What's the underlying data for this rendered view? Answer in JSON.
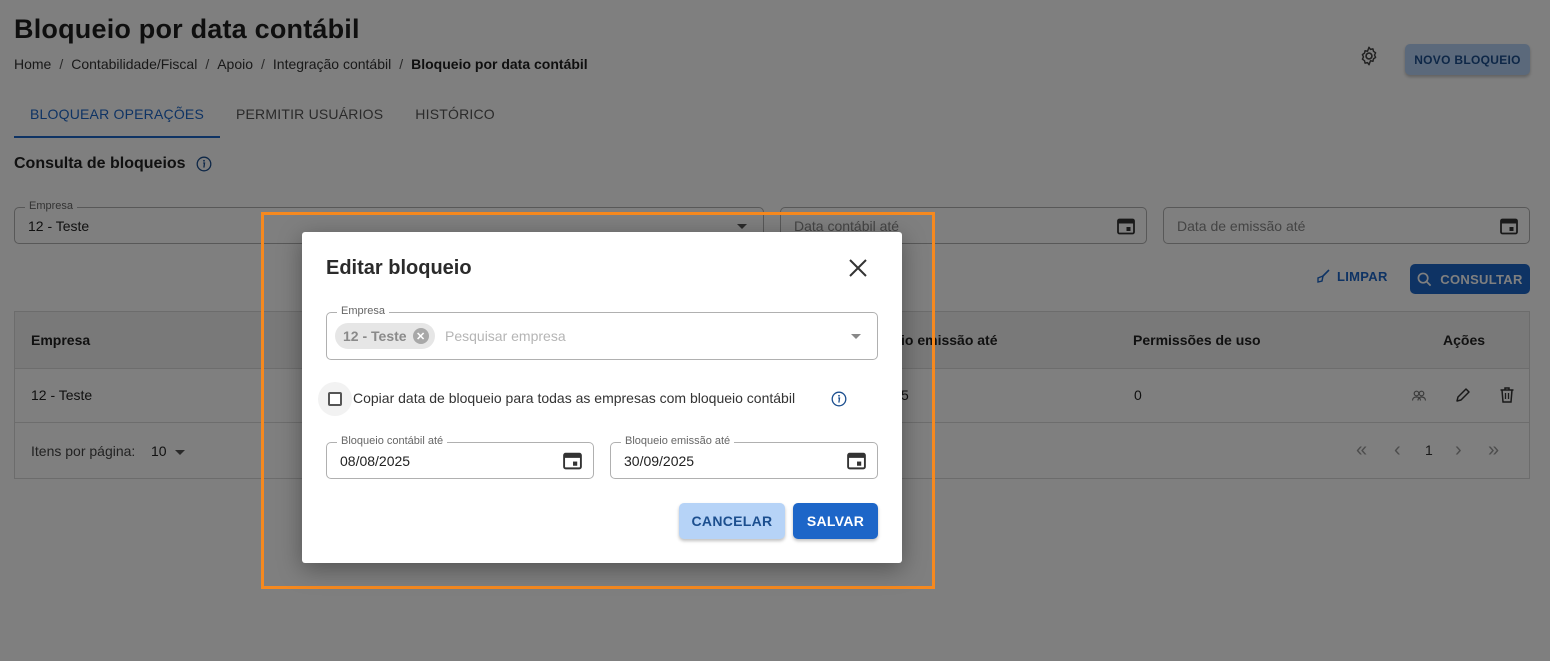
{
  "page": {
    "title": "Bloqueio por data contábil",
    "breadcrumb": [
      "Home",
      "Contabilidade/Fiscal",
      "Apoio",
      "Integração contábil",
      "Bloqueio por data contábil"
    ],
    "new_button": "NOVO BLOQUEIO"
  },
  "tabs": [
    "BLOQUEAR OPERAÇÕES",
    "PERMITIR USUÁRIOS",
    "HISTÓRICO"
  ],
  "filters": {
    "section_title": "Consulta de bloqueios",
    "empresa_label": "Empresa",
    "empresa_value": "12 - Teste",
    "data_contabil_placeholder": "Data contábil até",
    "data_emissao_placeholder": "Data de emissão até",
    "limpar": "LIMPAR",
    "consultar": "CONSULTAR"
  },
  "table": {
    "headers": [
      "Empresa",
      "io emissão até",
      "Permissões de uso",
      "Ações"
    ],
    "rows": [
      {
        "empresa": "12 - Teste",
        "data_emissao": "5",
        "permissoes": "0"
      }
    ],
    "items_per_page_label": "Itens por página:",
    "items_per_page_value": "10",
    "page_number": "1"
  },
  "dialog": {
    "title": "Editar bloqueio",
    "empresa_label": "Empresa",
    "empresa_chip": "12 - Teste",
    "empresa_search_placeholder": "Pesquisar empresa",
    "checkbox_label": "Copiar data de bloqueio para todas as empresas com bloqueio contábil",
    "bloqueio_contabil_label": "Bloqueio contábil até",
    "bloqueio_contabil_value": "08/08/2025",
    "bloqueio_emissao_label": "Bloqueio emissão até",
    "bloqueio_emissao_value": "30/09/2025",
    "cancel": "CANCELAR",
    "save": "SALVAR"
  },
  "colors": {
    "primary": "#1d66c8",
    "primary_light": "#b6d3f7",
    "highlight": "#f6891f"
  }
}
